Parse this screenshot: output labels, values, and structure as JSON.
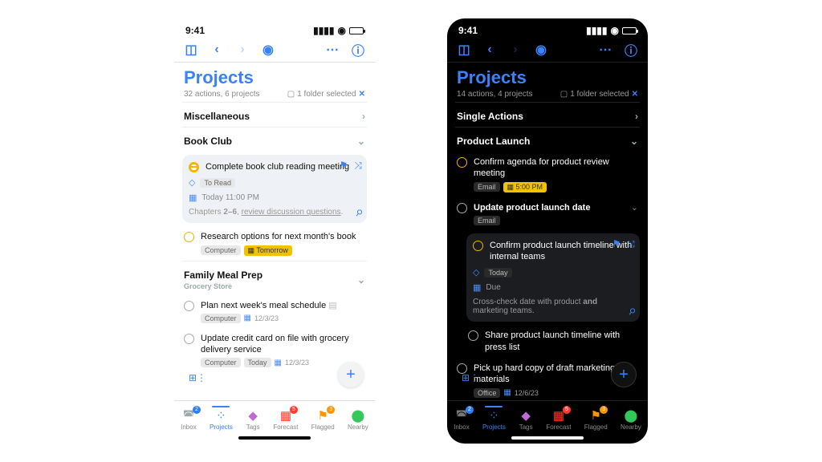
{
  "time": "9:41",
  "light": {
    "title": "Projects",
    "summary": "32 actions, 6 projects",
    "filter": "1 folder selected",
    "sections": {
      "0": {
        "name": "Miscellaneous"
      },
      "1": {
        "name": "Book Club"
      },
      "2": {
        "name": "Family Meal Prep",
        "sub": "Grocery Store"
      }
    },
    "tasks": {
      "t1": {
        "title": "Complete book club reading meeting",
        "tag": "To Read",
        "due": "Today 11:00 PM",
        "note_prefix": "Chapters ",
        "note_bold": "2–6",
        "note_rest": ", ",
        "note_link": "review discussion questions",
        "note_tail": "."
      },
      "t2": {
        "title": "Research options for next month's book",
        "tag": "Computer",
        "sched": "Tomorrow"
      },
      "t3": {
        "title": "Plan next week's meal schedule",
        "tag": "Computer",
        "date": "12/3/23"
      },
      "t4": {
        "title": "Update credit card on file with grocery delivery service",
        "tag1": "Computer",
        "tag2": "Today",
        "date": "12/3/23"
      }
    }
  },
  "dark": {
    "title": "Projects",
    "summary": "14 actions, 4 projects",
    "filter": "1 folder selected",
    "sections": {
      "0": {
        "name": "Single Actions"
      },
      "1": {
        "name": "Product Launch"
      }
    },
    "tasks": {
      "t1": {
        "title": "Confirm agenda for product review meeting",
        "tag": "Email",
        "sched": "5:00 PM"
      },
      "t2": {
        "title": "Update product launch date",
        "tag": "Email"
      },
      "t3": {
        "title": "Confirm product launch timeline with internal teams",
        "tagrow": "Today",
        "due": "Due",
        "note": "Cross-check date with product ",
        "note_bold": "and",
        "note_tail": " marketing teams."
      },
      "t4": {
        "title": "Share product launch timeline with press list"
      },
      "t5": {
        "title": "Pick up hard copy of draft marketing materials",
        "tag": "Office",
        "date": "12/6/23"
      }
    }
  },
  "tabs": {
    "0": {
      "label": "Inbox",
      "badge": "2"
    },
    "1": {
      "label": "Projects"
    },
    "2": {
      "label": "Tags"
    },
    "3": {
      "label": "Forecast",
      "badge": "5"
    },
    "4": {
      "label": "Flagged",
      "badge": "3"
    },
    "5": {
      "label": "Nearby"
    }
  }
}
